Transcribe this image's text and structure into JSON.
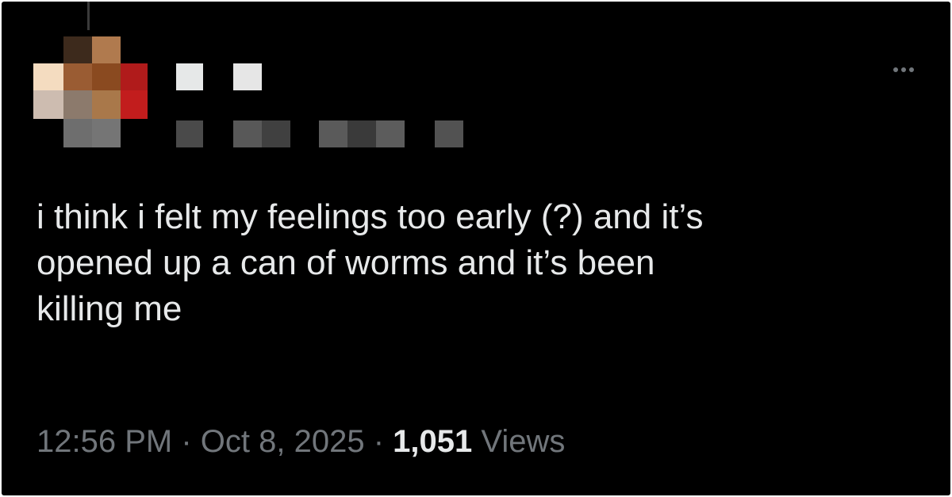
{
  "tweet": {
    "text_lines": [
      "i think i felt my feelings too early (?) and it’s",
      "opened up a can of worms and it’s been",
      "killing me"
    ],
    "time": "12:56 PM",
    "separator": "·",
    "date": "Oct 8, 2025",
    "views_count": "1,051",
    "views_label": "Views"
  },
  "author": {
    "display_name_redacted": true,
    "handle_redacted": true
  },
  "icons": {
    "more": "more-horizontal-icon"
  },
  "colors": {
    "background": "#000000",
    "text_primary": "#e7e9ea",
    "text_secondary": "#71767b"
  }
}
